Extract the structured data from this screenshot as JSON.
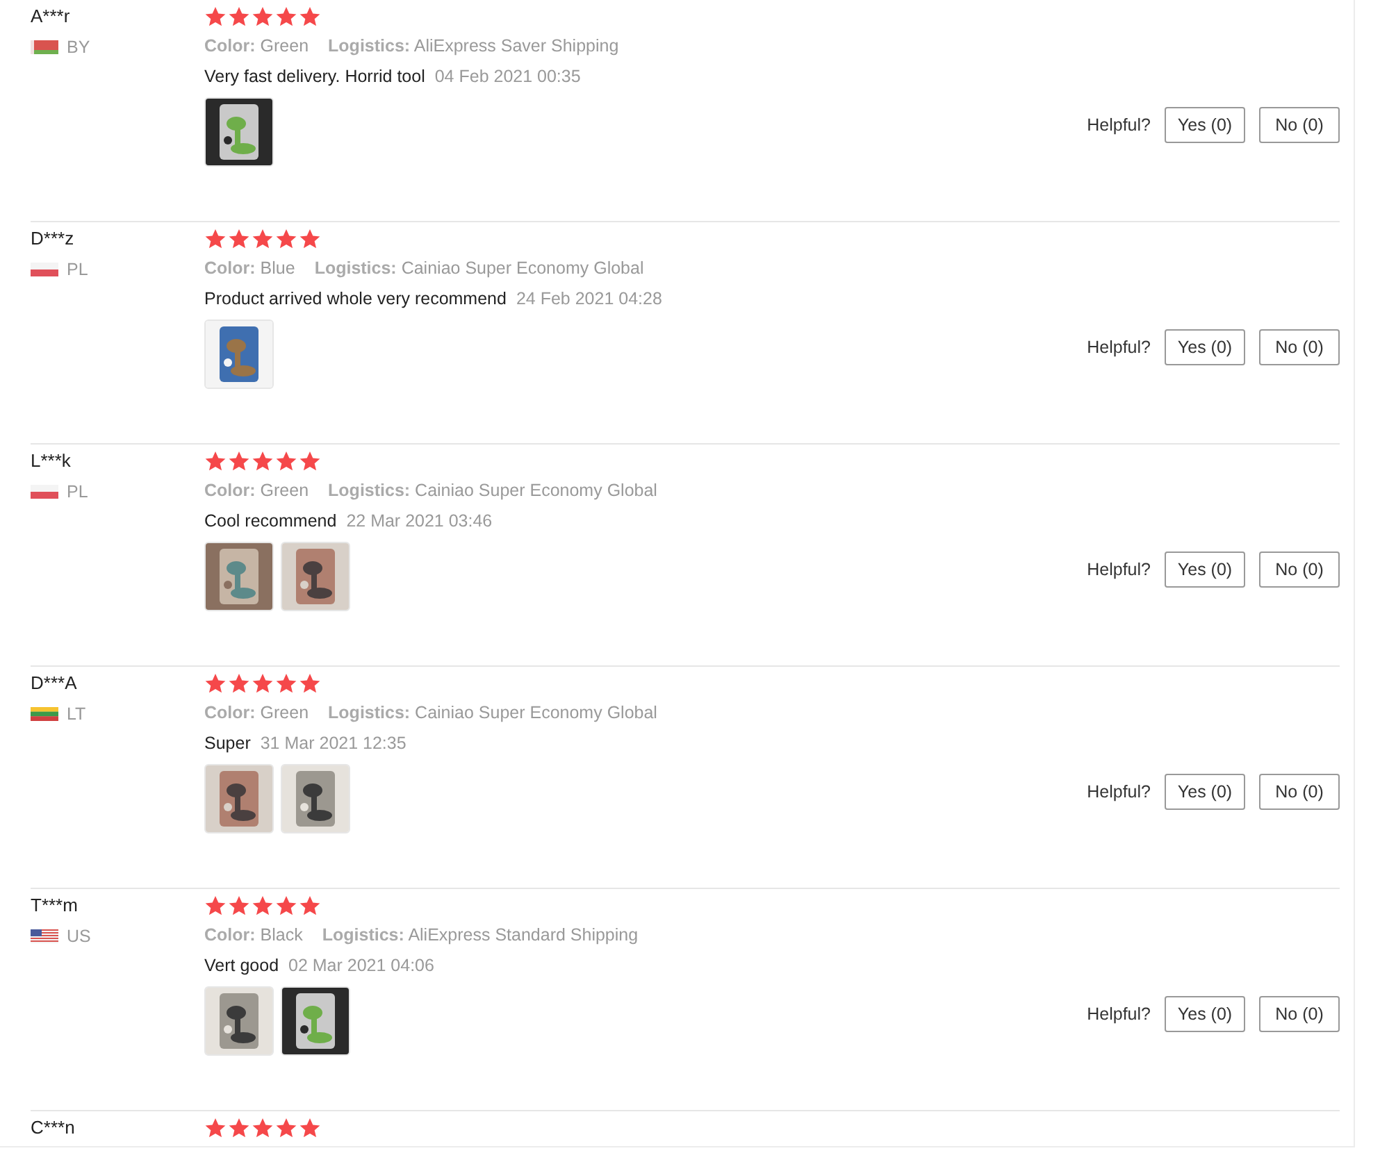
{
  "reviews": [
    {
      "name": "A***r",
      "flag": {
        "kind": "redgreen"
      },
      "country": "BY",
      "stars": 5,
      "color_label": "Color:",
      "variant": "Green",
      "logistics_label": "Logistics:",
      "logistics": "AliExpress Saver Shipping",
      "text": "Very fast delivery. Horrid tool",
      "date": "04 Feb 2021 00:35",
      "photos": [
        {
          "kind": "picture"
        }
      ],
      "helpful": "Helpful?",
      "yes": "Yes (0)",
      "no": "No (0)"
    },
    {
      "name": "D***z",
      "flag": {
        "kind": "whitered"
      },
      "country": "PL",
      "stars": 5,
      "color_label": "Color:",
      "variant": "Blue",
      "logistics_label": "Logistics:",
      "logistics": "Cainiao Super Economy Global",
      "text": "Product arrived whole very recommend",
      "date": "24 Feb 2021 04:28",
      "photos": [
        {
          "kind": "picture"
        }
      ],
      "helpful": "Helpful?",
      "yes": "Yes (0)",
      "no": "No (0)"
    },
    {
      "name": "L***k",
      "flag": {
        "kind": "whitered"
      },
      "country": "PL",
      "stars": 5,
      "color_label": "Color:",
      "variant": "Green",
      "logistics_label": "Logistics:",
      "logistics": "Cainiao Super Economy Global",
      "text": "Cool recommend",
      "date": "22 Mar 2021 03:46",
      "photos": [
        {
          "kind": "picture"
        },
        {
          "kind": "picture"
        }
      ],
      "helpful": "Helpful?",
      "yes": "Yes (0)",
      "no": "No (0)"
    },
    {
      "name": "D***A",
      "flag": {
        "kind": "tricolor"
      },
      "country": "LT",
      "stars": 5,
      "color_label": "Color:",
      "variant": "Green",
      "logistics_label": "Logistics:",
      "logistics": "Cainiao Super Economy Global",
      "text": "Super",
      "date": "31 Mar 2021 12:35",
      "photos": [
        {
          "kind": "picture"
        },
        {
          "kind": "picture"
        }
      ],
      "helpful": "Helpful?",
      "yes": "Yes (0)",
      "no": "No (0)"
    },
    {
      "name": "T***m",
      "flag": {
        "kind": "stripes"
      },
      "country": "US",
      "stars": 5,
      "color_label": "Color:",
      "variant": "Black",
      "logistics_label": "Logistics:",
      "logistics": "AliExpress Standard Shipping",
      "text": "Vert good",
      "date": "02 Mar 2021 04:06",
      "photos": [
        {
          "kind": "picture"
        },
        {
          "kind": "picture"
        }
      ],
      "helpful": "Helpful?",
      "yes": "Yes (0)",
      "no": "No (0)"
    },
    {
      "name": "C***n",
      "stars": 5
    }
  ]
}
